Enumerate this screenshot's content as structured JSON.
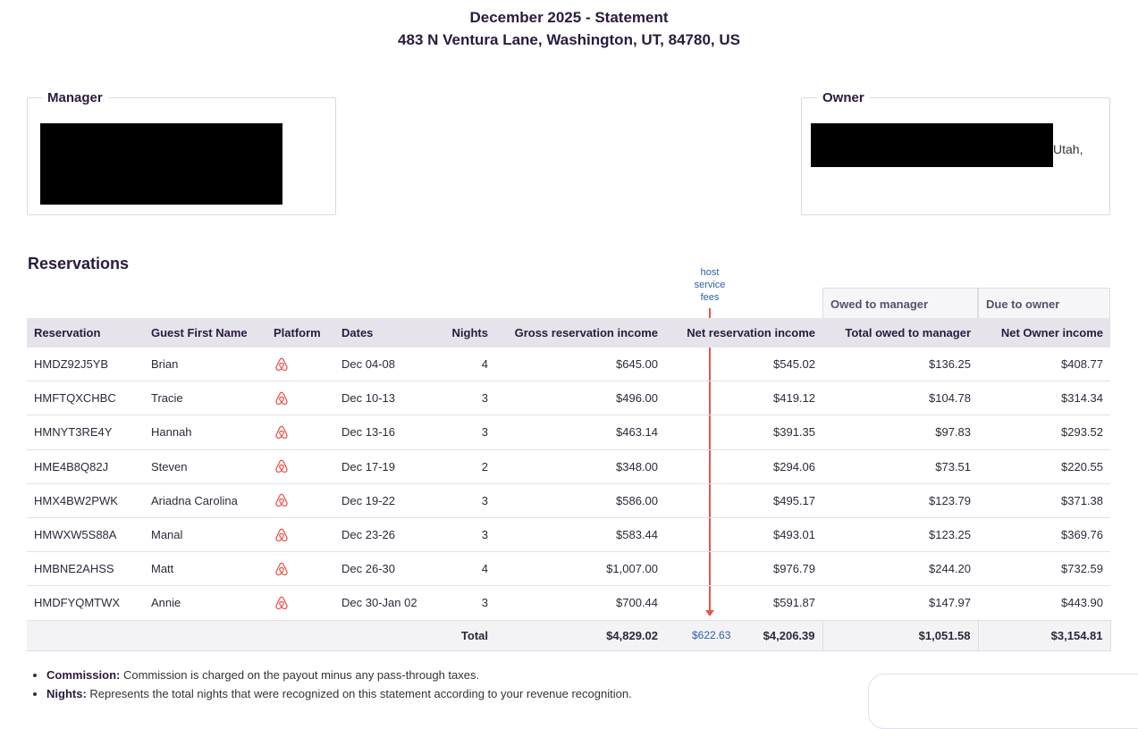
{
  "statement": {
    "title": "December 2025 - Statement",
    "address": "483 N Ventura Lane, Washington, UT, 84780, US"
  },
  "manager": {
    "label": "Manager"
  },
  "owner": {
    "label": "Owner",
    "address_fragment": "Utah,"
  },
  "reservations": {
    "title": "Reservations",
    "annotation": [
      "host",
      "service",
      "fees"
    ],
    "group_headers": {
      "owed_to_manager": "Owed to manager",
      "due_to_owner": "Due to owner"
    },
    "columns": {
      "reservation": "Reservation",
      "guest": "Guest First Name",
      "platform": "Platform",
      "dates": "Dates",
      "nights": "Nights",
      "gross": "Gross reservation income",
      "net": "Net reservation income",
      "total_owed": "Total owed to manager",
      "net_owner": "Net Owner income"
    },
    "platform_icon": "airbnb-icon",
    "rows": [
      {
        "id": "HMDZ92J5YB",
        "guest": "Brian",
        "dates": "Dec 04-08",
        "nights": "4",
        "gross": "$645.00",
        "net": "$545.02",
        "owed": "$136.25",
        "owner": "$408.77"
      },
      {
        "id": "HMFTQXCHBC",
        "guest": "Tracie",
        "dates": "Dec 10-13",
        "nights": "3",
        "gross": "$496.00",
        "net": "$419.12",
        "owed": "$104.78",
        "owner": "$314.34"
      },
      {
        "id": "HMNYT3RE4Y",
        "guest": "Hannah",
        "dates": "Dec 13-16",
        "nights": "3",
        "gross": "$463.14",
        "net": "$391.35",
        "owed": "$97.83",
        "owner": "$293.52"
      },
      {
        "id": "HME4B8Q82J",
        "guest": "Steven",
        "dates": "Dec 17-19",
        "nights": "2",
        "gross": "$348.00",
        "net": "$294.06",
        "owed": "$73.51",
        "owner": "$220.55"
      },
      {
        "id": "HMX4BW2PWK",
        "guest": "Ariadna Carolina",
        "dates": "Dec 19-22",
        "nights": "3",
        "gross": "$586.00",
        "net": "$495.17",
        "owed": "$123.79",
        "owner": "$371.38"
      },
      {
        "id": "HMWXW5S88A",
        "guest": "Manal",
        "dates": "Dec 23-26",
        "nights": "3",
        "gross": "$583.44",
        "net": "$493.01",
        "owed": "$123.25",
        "owner": "$369.76"
      },
      {
        "id": "HMBNE2AHSS",
        "guest": "Matt",
        "dates": "Dec 26-30",
        "nights": "4",
        "gross": "$1,007.00",
        "net": "$976.79",
        "owed": "$244.20",
        "owner": "$732.59"
      },
      {
        "id": "HMDFYQMTWX",
        "guest": "Annie",
        "dates": "Dec 30-Jan 02",
        "nights": "3",
        "gross": "$700.44",
        "net": "$591.87",
        "owed": "$147.97",
        "owner": "$443.90"
      }
    ],
    "total": {
      "label": "Total",
      "gross": "$4,829.02",
      "fees": "$622.63",
      "net": "$4,206.39",
      "owed": "$1,051.58",
      "owner": "$3,154.81"
    }
  },
  "notes": [
    {
      "term": "Commission:",
      "text": " Commission is charged on the payout minus any pass-through taxes."
    },
    {
      "term": "Nights:",
      "text": " Represents the total nights that were recognized on this statement according to your revenue recognition."
    }
  ],
  "colors": {
    "accent": "#2a1b3d",
    "airbnb": "#e6534b",
    "annotation": "#2f5ea8",
    "arrow": "#e4574b"
  }
}
